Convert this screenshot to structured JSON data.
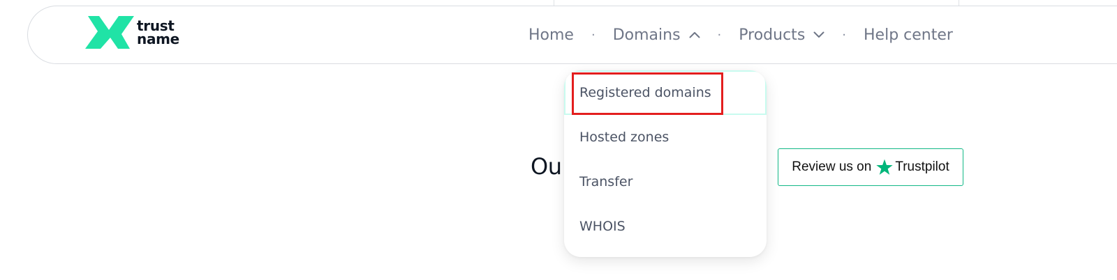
{
  "brand": {
    "logo_line1": "trust",
    "logo_line2": "name",
    "accent_color": "#20e3a6"
  },
  "nav": {
    "items": [
      {
        "label": "Home",
        "icon": null
      },
      {
        "label": "Domains",
        "icon": "chevron-up-icon",
        "expanded": true
      },
      {
        "label": "Products",
        "icon": "chevron-down-icon",
        "expanded": false
      },
      {
        "label": "Help center",
        "icon": null
      }
    ],
    "separator": "·"
  },
  "dropdown": {
    "items": [
      {
        "label": "Registered domains",
        "highlighted": true
      },
      {
        "label": "Hosted zones"
      },
      {
        "label": "Transfer"
      },
      {
        "label": "WHOIS"
      }
    ]
  },
  "hero": {
    "visible_text": "Ou"
  },
  "trustpilot": {
    "prefix": "Review us on",
    "brand": "Trustpilot",
    "icon": "star-icon",
    "color": "#00b67a"
  },
  "annotation": {
    "highlight_color": "#e31e1e"
  }
}
